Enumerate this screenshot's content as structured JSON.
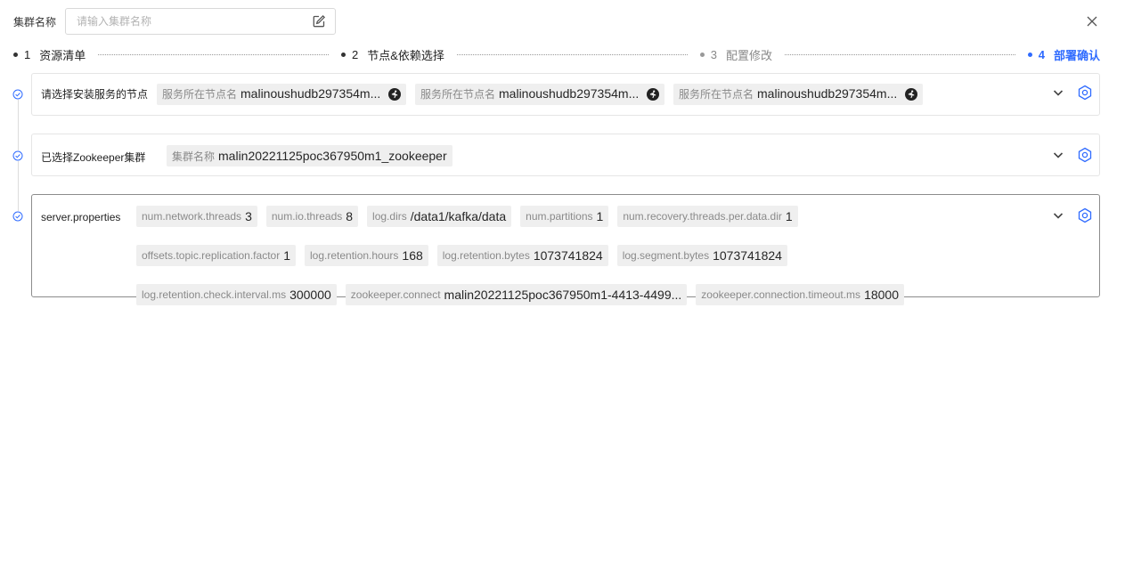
{
  "header": {
    "cluster_name_label": "集群名称",
    "cluster_name_placeholder": "请输入集群名称",
    "cluster_name_value": ""
  },
  "steps": [
    {
      "num": "1",
      "label": "资源清单",
      "state": "done"
    },
    {
      "num": "2",
      "label": "节点&依赖选择",
      "state": "done"
    },
    {
      "num": "3",
      "label": "配置修改",
      "state": "pending"
    },
    {
      "num": "4",
      "label": "部署确认",
      "state": "active"
    }
  ],
  "nodes_section": {
    "title": "请选择安装服务的节点",
    "tags": [
      {
        "key": "服务所在节点名",
        "value": "malinoushudb297354m..."
      },
      {
        "key": "服务所在节点名",
        "value": "malinoushudb297354m..."
      },
      {
        "key": "服务所在节点名",
        "value": "malinoushudb297354m..."
      }
    ]
  },
  "zk_section": {
    "title": "已选择Zookeeper集群",
    "tags": [
      {
        "key": "集群名称",
        "value": "malin20221125poc367950m1_zookeeper"
      }
    ]
  },
  "props_section": {
    "title": "server.properties",
    "tags": [
      {
        "key": "num.network.threads",
        "value": "3"
      },
      {
        "key": "num.io.threads",
        "value": "8"
      },
      {
        "key": "log.dirs",
        "value": "/data1/kafka/data"
      },
      {
        "key": "num.partitions",
        "value": "1"
      },
      {
        "key": "num.recovery.threads.per.data.dir",
        "value": "1"
      },
      {
        "key": "offsets.topic.replication.factor",
        "value": "1"
      },
      {
        "key": "log.retention.hours",
        "value": "168"
      },
      {
        "key": "log.retention.bytes",
        "value": "1073741824"
      },
      {
        "key": "log.segment.bytes",
        "value": "1073741824"
      },
      {
        "key": "log.retention.check.interval.ms",
        "value": "300000"
      },
      {
        "key": "zookeeper.connect",
        "value": "malin20221125poc367950m1-4413-4499..."
      },
      {
        "key": "zookeeper.connection.timeout.ms",
        "value": "18000"
      }
    ]
  },
  "colors": {
    "accent": "#2f6bff",
    "tag_bg": "#efefef",
    "border": "#e5e5e5"
  },
  "icons": {
    "edit": "edit-icon",
    "close": "close-icon",
    "chevron": "chevron-down-icon",
    "settings": "settings-icon",
    "check": "check-circle-icon",
    "node": "node-run-icon"
  }
}
